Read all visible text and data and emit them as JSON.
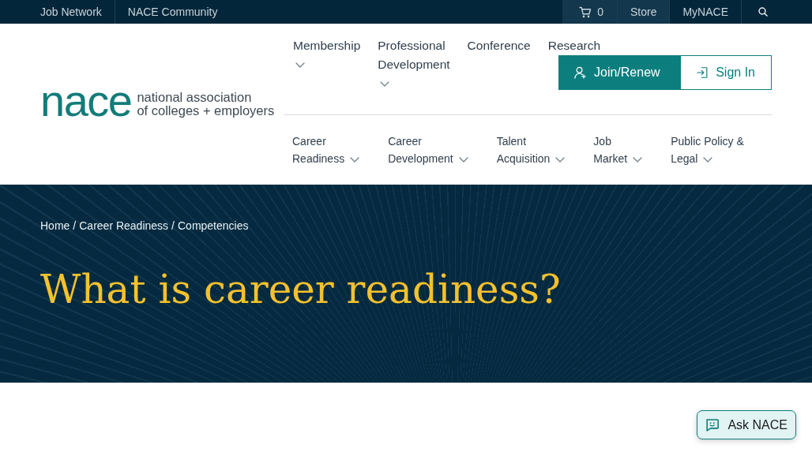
{
  "top_bar": {
    "left_links": [
      "Job Network",
      "NACE Community"
    ],
    "cart": {
      "count": "0",
      "highlighted": true
    },
    "right_links": [
      {
        "label": "Store",
        "highlighted": true
      },
      {
        "label": "MyNACE",
        "highlighted": false
      }
    ]
  },
  "logo": {
    "wordmark": "nace",
    "tagline": [
      "national association",
      "of colleges + employers"
    ]
  },
  "main_nav": [
    {
      "lines": [
        "Membership"
      ],
      "dropdown": true
    },
    {
      "lines": [
        "Professional",
        "Development"
      ],
      "dropdown": true
    },
    {
      "lines": [
        "Conference"
      ],
      "dropdown": false
    },
    {
      "lines": [
        "Research"
      ],
      "dropdown": false
    }
  ],
  "account_buttons": [
    {
      "kind": "join",
      "label": "Join/Renew"
    },
    {
      "kind": "sign_in",
      "label": "Sign In"
    }
  ],
  "topic_nav": [
    {
      "lines": [
        "Career",
        "Readiness"
      ],
      "dropdown": true
    },
    {
      "lines": [
        "Career",
        "Development"
      ],
      "dropdown": true
    },
    {
      "lines": [
        "Talent",
        "Acquisition"
      ],
      "dropdown": true
    },
    {
      "lines": [
        "Job",
        "Market"
      ],
      "dropdown": true
    },
    {
      "lines": [
        "Public Policy &",
        "Legal"
      ],
      "dropdown": true
    }
  ],
  "breadcrumb": {
    "items": [
      "Home",
      "Career Readiness",
      "Competencies"
    ],
    "separator": "/"
  },
  "hero": {
    "title": "What is career readiness?"
  },
  "chat_button": {
    "label": "Ask NACE"
  }
}
